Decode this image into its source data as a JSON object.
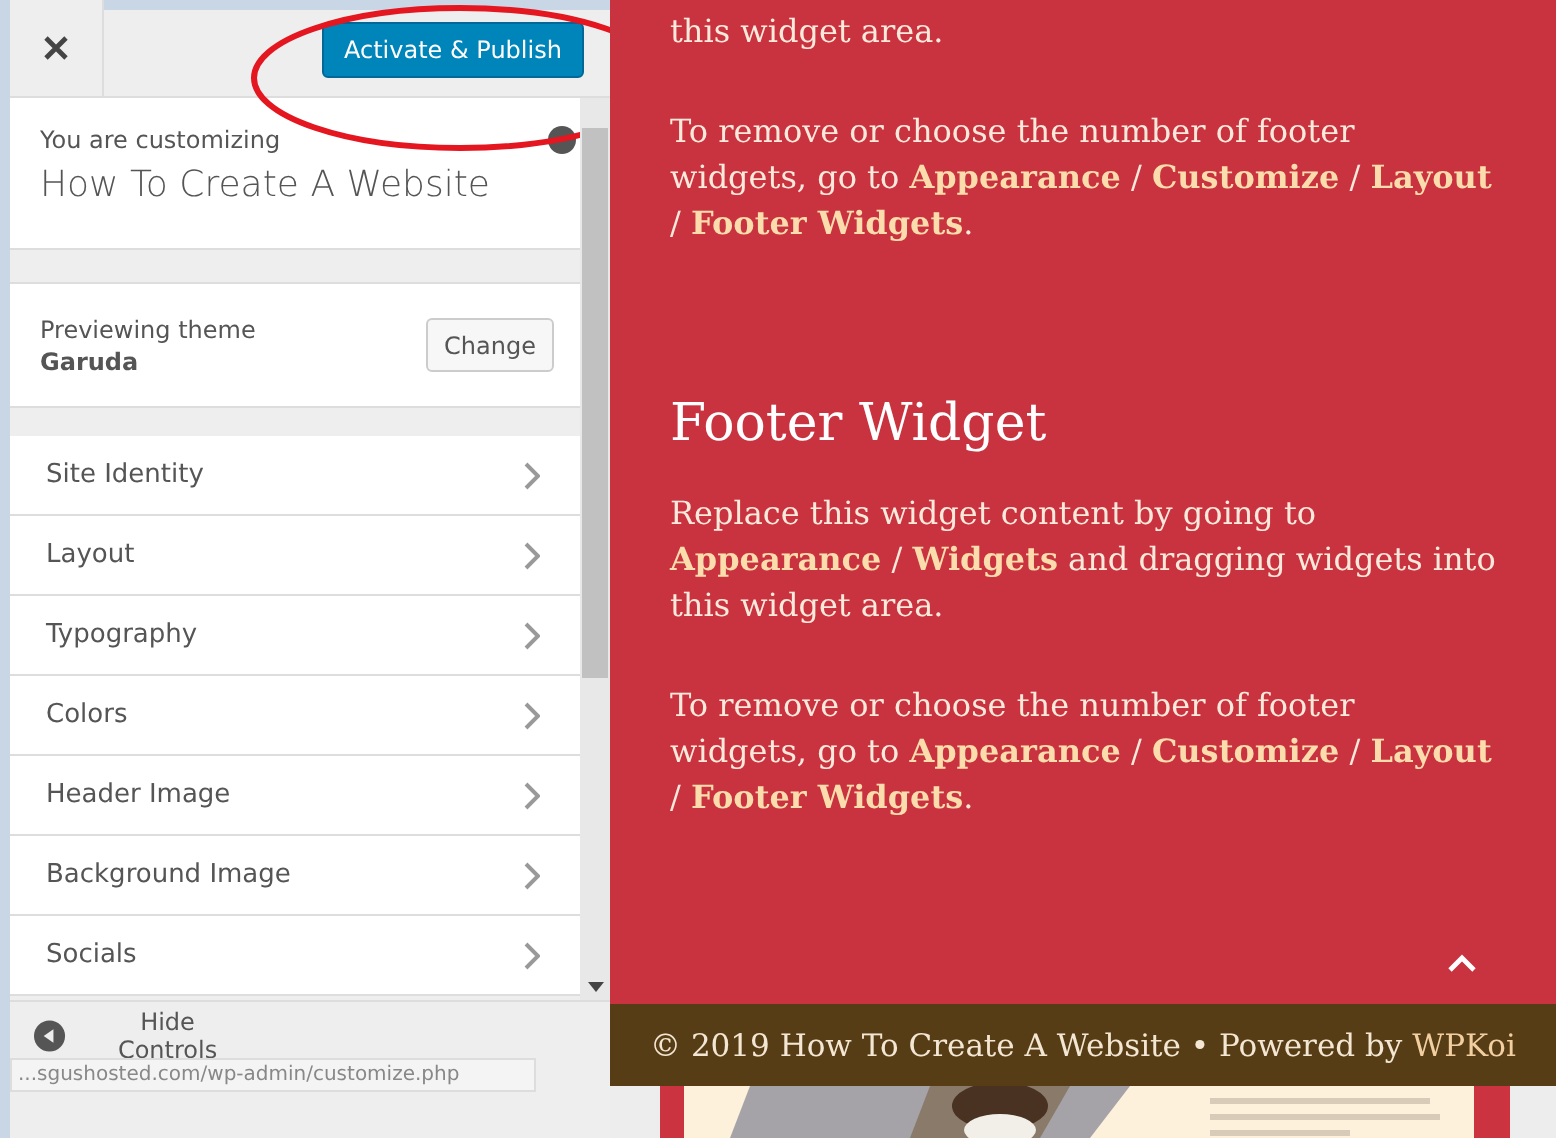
{
  "header": {
    "publish_button": "Activate & Publish"
  },
  "site_info": {
    "label": "You are customizing",
    "title": "How To Create A Website"
  },
  "theme": {
    "label": "Previewing theme",
    "name": "Garuda",
    "button": "Change"
  },
  "sections": [
    {
      "label": "Site Identity"
    },
    {
      "label": "Layout"
    },
    {
      "label": "Typography"
    },
    {
      "label": "Colors"
    },
    {
      "label": "Header Image"
    },
    {
      "label": "Background Image"
    },
    {
      "label": "Socials"
    }
  ],
  "footer": {
    "hide_controls": "Hide Controls",
    "status_url": "...sgushosted.com/wp-admin/customize.php"
  },
  "preview": {
    "blocks": [
      {
        "kind": "paragraph",
        "text": "this widget area."
      },
      {
        "kind": "paragraph",
        "text": "To remove or choose the number of footer widgets, go to **Appearance** / **Customize** / **Layout** / **Footer Widgets**."
      },
      {
        "kind": "heading",
        "text": "Footer Widget"
      },
      {
        "kind": "paragraph",
        "text": "Replace this widget content by going to **Appearance** / **Widgets** and dragging widgets into this widget area."
      },
      {
        "kind": "paragraph",
        "text": "To remove or choose the number of footer widgets, go to **Appearance** / **Customize** / **Layout** / **Footer Widgets**."
      }
    ],
    "credit": "© 2019 How To Create A Website • Powered by",
    "credit_link": "WPKoi"
  }
}
